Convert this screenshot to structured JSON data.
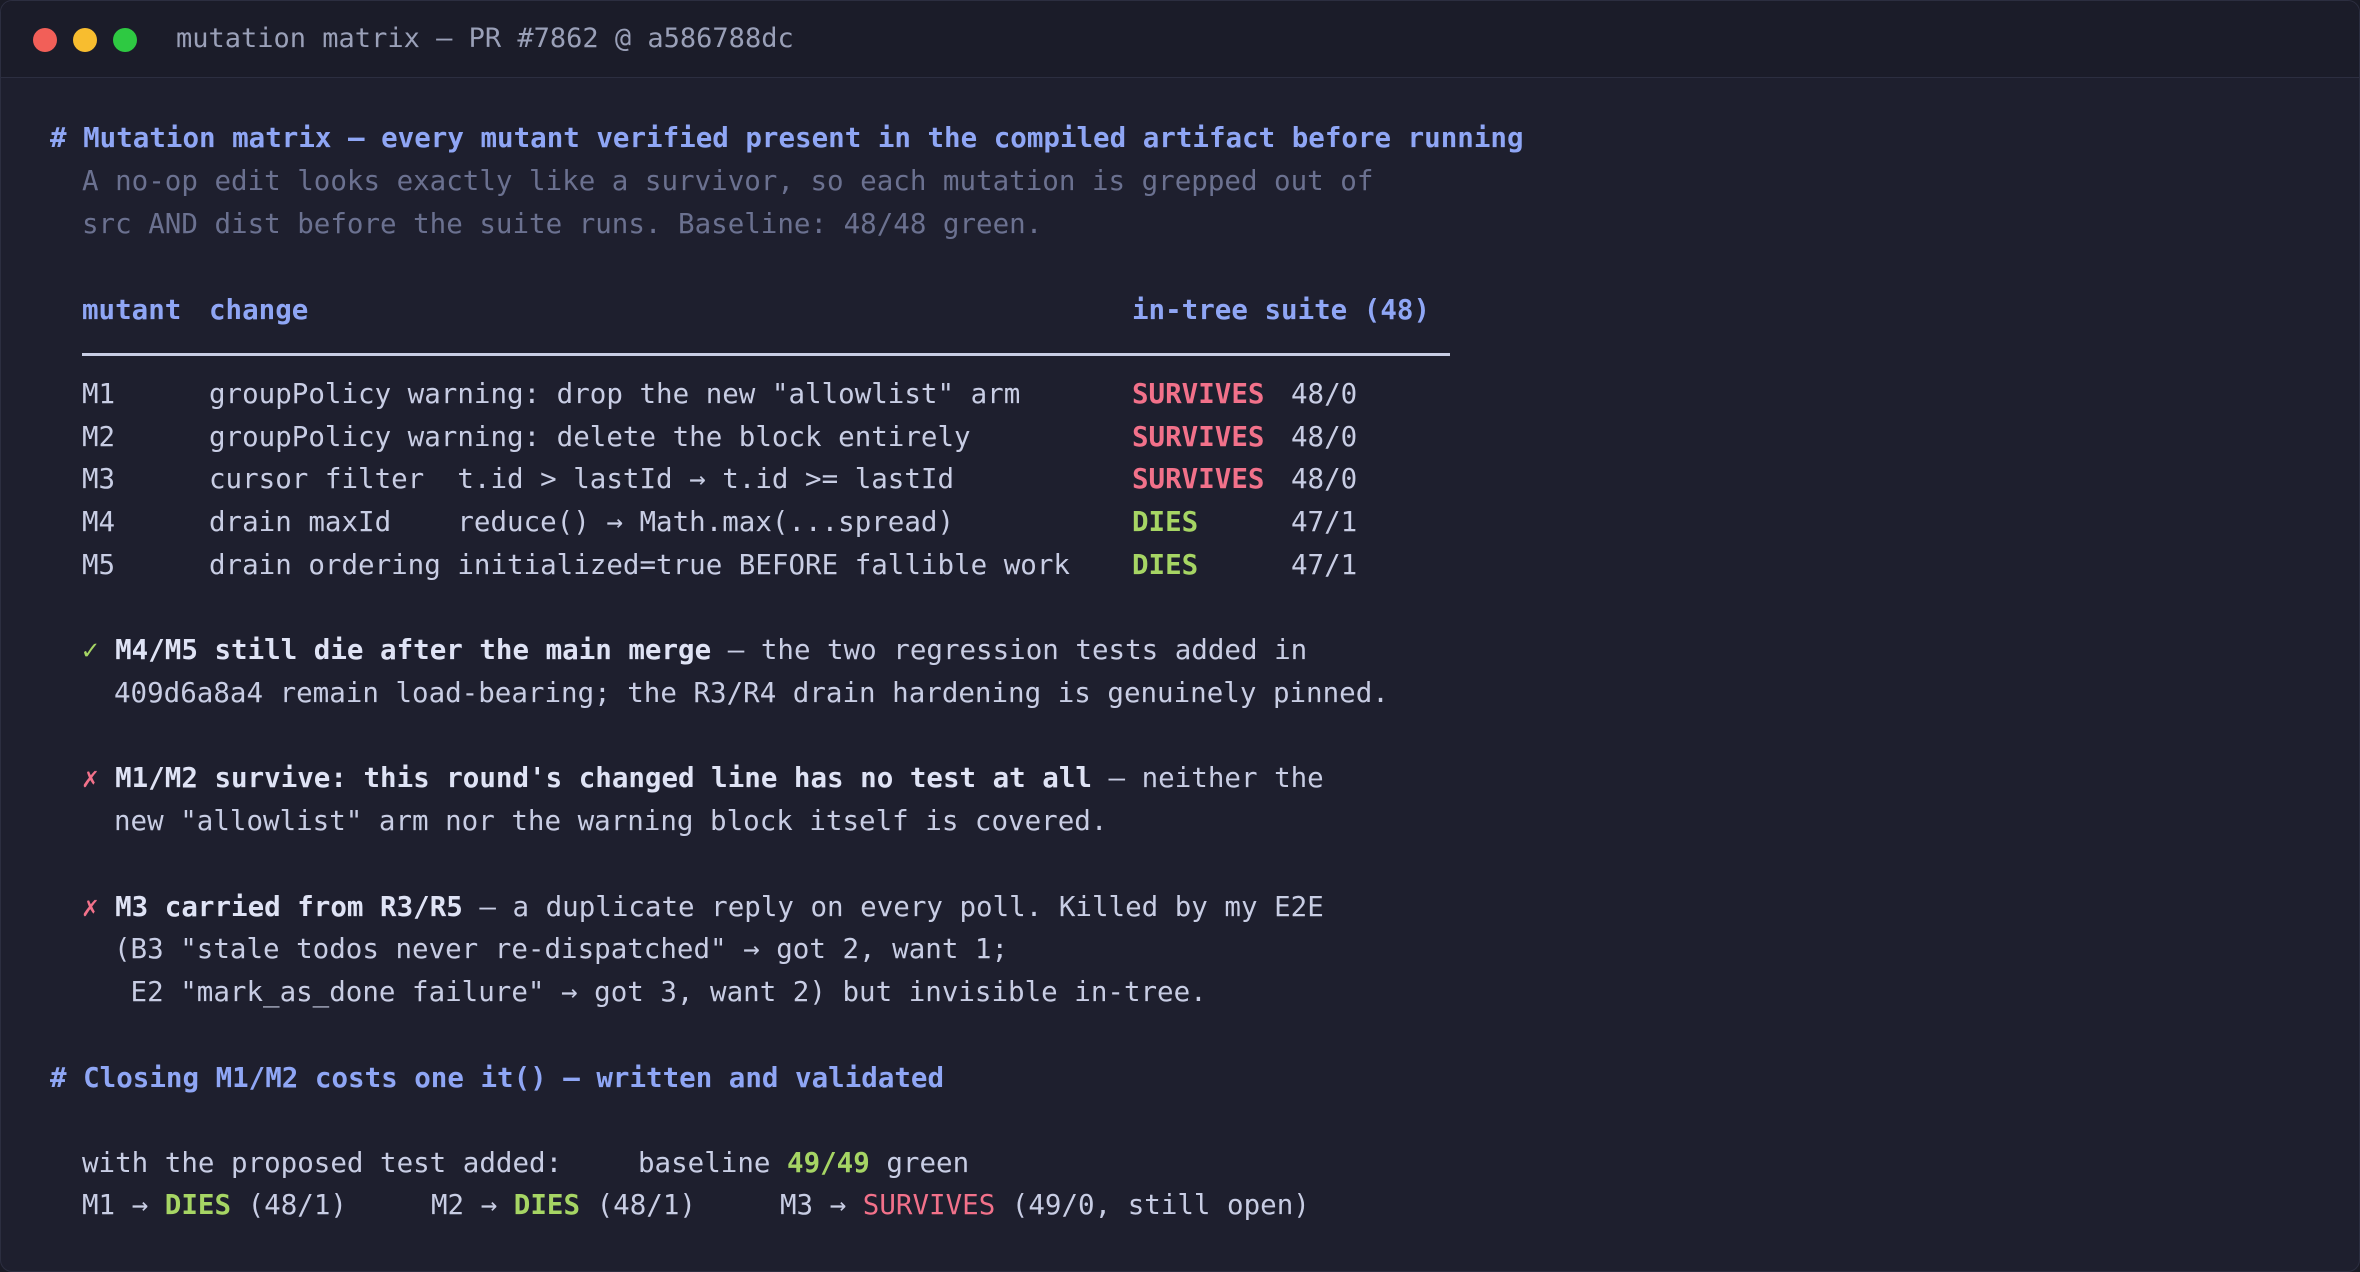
{
  "window": {
    "title": "mutation matrix — PR #7862 @ a586788dc",
    "controls": [
      "close",
      "minimize",
      "maximize"
    ]
  },
  "section1": {
    "heading": "# Mutation matrix — every mutant verified present in the compiled artifact before running",
    "intro_line1": "A no-op edit looks exactly like a survivor, so each mutation is grepped out of",
    "intro_line2": "src AND dist before the suite runs. Baseline: 48/48 green."
  },
  "table": {
    "headers": {
      "mutant": "mutant",
      "change": "change",
      "suite": "in-tree suite (48)"
    },
    "rows": [
      {
        "id": "M1",
        "change": "groupPolicy warning: drop the new \"allowlist\" arm",
        "result": "SURVIVES",
        "score": "48/0"
      },
      {
        "id": "M2",
        "change": "groupPolicy warning: delete the block entirely",
        "result": "SURVIVES",
        "score": "48/0"
      },
      {
        "id": "M3",
        "change": "cursor filter  t.id > lastId → t.id >= lastId",
        "result": "SURVIVES",
        "score": "48/0"
      },
      {
        "id": "M4",
        "change": "drain maxId    reduce() → Math.max(...spread)",
        "result": "DIES",
        "score": "47/1"
      },
      {
        "id": "M5",
        "change": "drain ordering initialized=true BEFORE fallible work",
        "result": "DIES",
        "score": "47/1"
      }
    ]
  },
  "notes": {
    "n1": {
      "marker": "✓",
      "bold": "M4/M5 still die after the main merge",
      "rest": " — the two regression tests added in",
      "line2": "409d6a8a4 remain load-bearing; the R3/R4 drain hardening is genuinely pinned."
    },
    "n2": {
      "marker": "✗",
      "bold": "M1/M2 survive: this round's changed line has no test at all",
      "rest": " — neither the",
      "line2": "new \"allowlist\" arm nor the warning block itself is covered."
    },
    "n3": {
      "marker": "✗",
      "bold": "M3 carried from R3/R5",
      "rest": " — a duplicate reply on every poll. Killed by my E2E",
      "line2": "(B3 \"stale todos never re-dispatched\" → got 2, want 1;",
      "line3": " E2 \"mark_as_done failure\" → got 3, want 2) but invisible in-tree."
    }
  },
  "section2": {
    "heading": "# Closing M1/M2 costs one it() — written and validated",
    "proposed_label": "with the proposed test added:",
    "baseline_prefix": "baseline ",
    "baseline_value": "49/49",
    "baseline_suffix": " green",
    "results": [
      {
        "prefix": "M1 → ",
        "status": "DIES",
        "detail": " (48/1)"
      },
      {
        "prefix": "M2 → ",
        "status": "DIES",
        "detail": " (48/1)"
      },
      {
        "prefix": "M3 → ",
        "status": "SURVIVES",
        "detail": " (49/0, still open)"
      }
    ]
  },
  "colors": {
    "background": "#1e1f2e",
    "heading": "#8fa6f5",
    "survives": "#f2718a",
    "dies": "#a6d564",
    "text": "#c8cde4",
    "muted": "#6b7190"
  }
}
